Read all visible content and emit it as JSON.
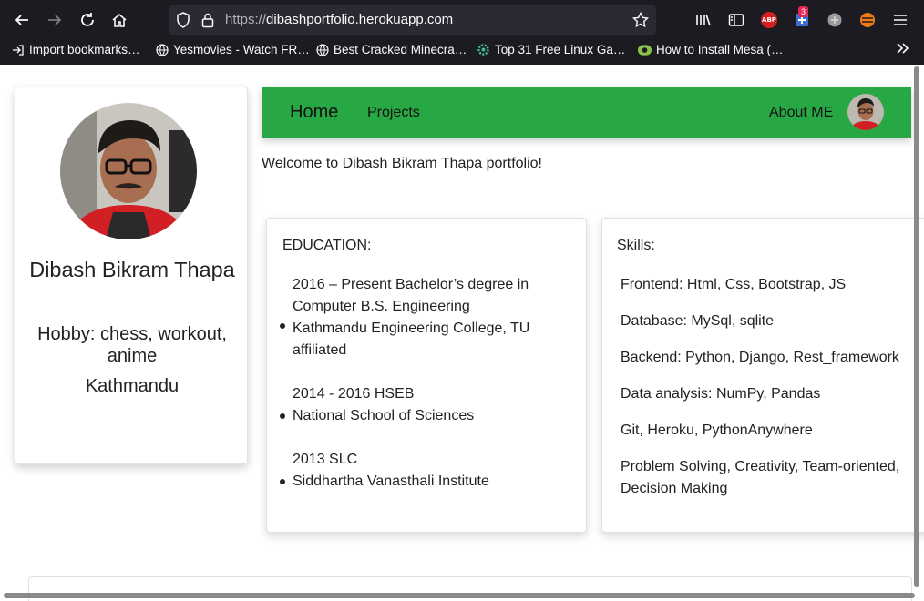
{
  "browser": {
    "url_scheme": "https://",
    "url_host": "dibashportfolio.herokuapp.com",
    "abp_label": "ABP",
    "notification_count": "3",
    "bookmarks": [
      {
        "label": "Import bookmarks…",
        "icon": "import-icon"
      },
      {
        "label": "Yesmovies - Watch FR…",
        "icon": "globe-icon"
      },
      {
        "label": "Best Cracked Minecra…",
        "icon": "globe-icon"
      },
      {
        "label": "Top 31 Free Linux Ga…",
        "icon": "gear-icon"
      },
      {
        "label": "How to Install Mesa (…",
        "icon": "site-icon"
      }
    ]
  },
  "profile": {
    "name": "Dibash Bikram Thapa",
    "hobby": "Hobby: chess, workout, anime",
    "location": "Kathmandu"
  },
  "navbar": {
    "brand": "Home",
    "projects": "Projects",
    "about": "About ME",
    "bg_color": "#28a745"
  },
  "welcome": "Welcome to Dibash Bikram Thapa portfolio!",
  "education": {
    "title": "EDUCATION:",
    "items": [
      {
        "period": "2016 – Present Bachelor’s degree in Computer B.S. Engineering",
        "school": "Kathmandu Engineering College, TU affiliated"
      },
      {
        "period": "2014 - 2016 HSEB",
        "school": "National School of Sciences"
      },
      {
        "period": "2013 SLC",
        "school": "Siddhartha Vanasthali Institute"
      }
    ]
  },
  "skills": {
    "title": "Skills:",
    "items": [
      "Frontend: Html, Css, Bootstrap, JS",
      "Database: MySql, sqlite",
      "Backend: Python, Django, Rest_framework",
      "Data analysis: NumPy, Pandas",
      "Git, Heroku, PythonAnywhere",
      "Problem Solving, Creativity, Team-oriented, Decision Making"
    ]
  }
}
